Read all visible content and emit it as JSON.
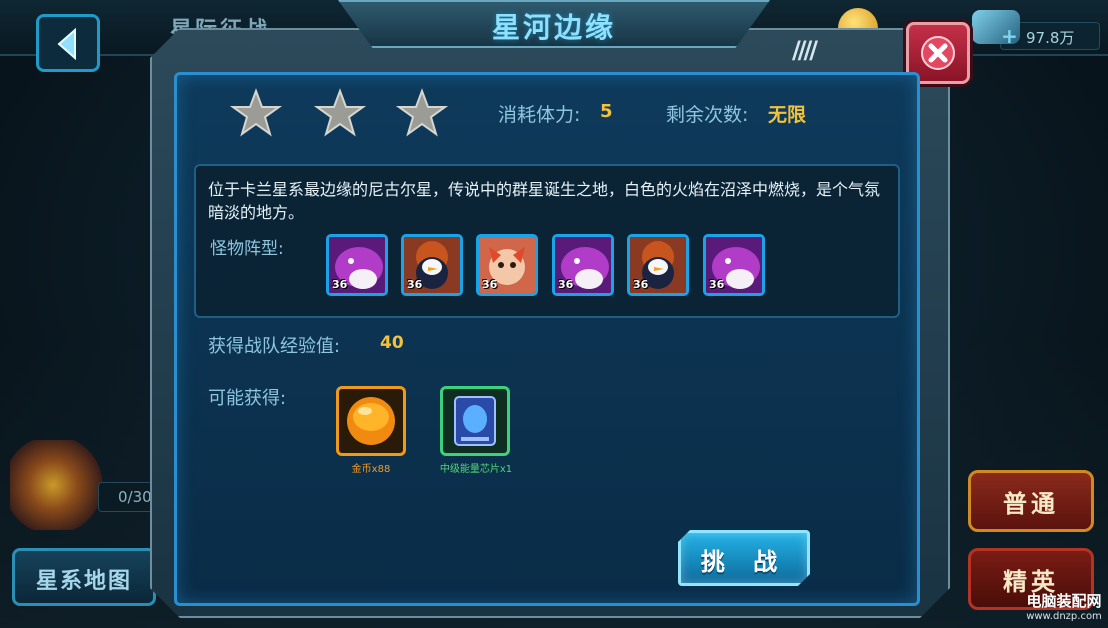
{
  "background": {
    "screen_title": "星际征战",
    "resource_amount": "97.8万",
    "progress_label": "0/30",
    "star_map_button": "星系地图",
    "mode_normal_button": "普通",
    "mode_elite_button": "精英"
  },
  "dialog": {
    "title": "星河边缘",
    "star_count": 3,
    "stamina_label": "消耗体力:",
    "stamina_value": "5",
    "remaining_label": "剩余次数:",
    "remaining_value": "无限",
    "description": "位于卡兰星系最边缘的尼古尔星，传说中的群星诞生之地，白色的火焰在沼泽中燃烧，是个气氛暗淡的地方。",
    "monster_label": "怪物阵型:",
    "monsters": [
      {
        "level": "36",
        "type": "purple-beast"
      },
      {
        "level": "36",
        "type": "penguin"
      },
      {
        "level": "36",
        "type": "flame-fox"
      },
      {
        "level": "36",
        "type": "purple-beast"
      },
      {
        "level": "36",
        "type": "penguin"
      },
      {
        "level": "36",
        "type": "purple-beast"
      }
    ],
    "exp_label": "获得战队经验值:",
    "exp_value": "40",
    "drops_label": "可能获得:",
    "rewards": [
      {
        "caption": "金币x88",
        "icon": "gold-orb-icon",
        "color": "#f09a1c"
      },
      {
        "caption": "中级能量芯片x1",
        "icon": "energy-chip-icon",
        "color": "#3ed07a"
      }
    ],
    "challenge_button": "挑 战"
  },
  "watermark": {
    "line1": "电脑装配网",
    "line2": "www.dnzp.com"
  },
  "colors": {
    "accent": "#2a8fd0",
    "highlight": "#f2c23b",
    "close": "#c43048"
  }
}
